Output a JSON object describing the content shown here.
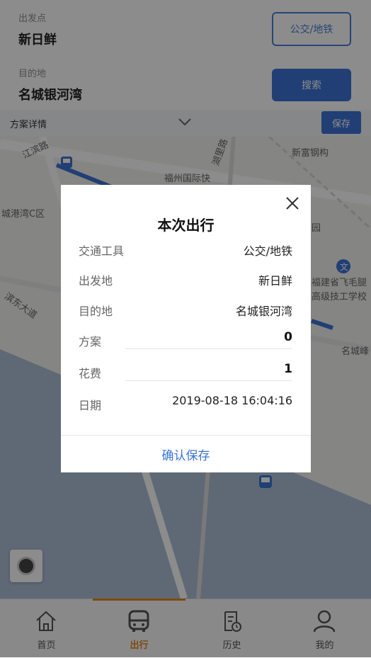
{
  "form": {
    "origin_label": "出发点",
    "origin_value": "新日鲜",
    "dest_label": "目的地",
    "dest_value": "名城银河湾",
    "mode_button": "公交/地铁",
    "search_button": "搜索",
    "plan_label": "方案详情",
    "save_button": "保存"
  },
  "map": {
    "labels": [
      "江滨路",
      "福州国际快",
      "新富钢构",
      "城港湾C区",
      "福建省飞毛腿",
      "高级技工学校",
      "滨东大道",
      "名城峰",
      "湖里路",
      "园"
    ]
  },
  "modal": {
    "title": "本次出行",
    "rows": [
      {
        "label": "交通工具",
        "value": "公交/地铁"
      },
      {
        "label": "出发地",
        "value": "新日鲜"
      },
      {
        "label": "目的地",
        "value": "名城银河湾"
      },
      {
        "label": "方案",
        "value": "0"
      },
      {
        "label": "花费",
        "value": "1"
      },
      {
        "label": "日期",
        "value": "2019-08-18 16:04:16"
      }
    ],
    "confirm": "确认保存"
  },
  "nav": {
    "items": [
      {
        "label": "首页",
        "icon": "home-icon"
      },
      {
        "label": "出行",
        "icon": "bus-icon"
      },
      {
        "label": "历史",
        "icon": "history-icon"
      },
      {
        "label": "我的",
        "icon": "user-icon"
      }
    ],
    "active_index": 1,
    "active_color": "#e0891f"
  },
  "colors": {
    "accent": "#3c74d6",
    "nav_active": "#e0891f"
  }
}
